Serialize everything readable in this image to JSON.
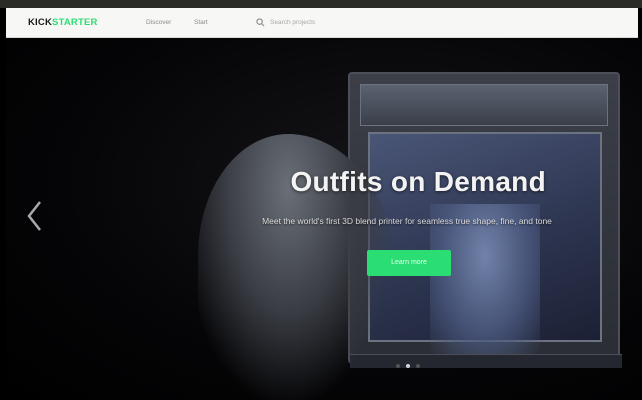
{
  "navbar": {
    "logo_main": "KICK",
    "logo_accent": "STARTER",
    "links": [
      "Discover",
      "Start"
    ],
    "search_placeholder": "Search projects"
  },
  "hero": {
    "title": "Outfits on Demand",
    "subtitle": "Meet the world's first 3D blend printer for seamless true shape, fine, and tone",
    "cta_label": "Learn more"
  },
  "carousel": {
    "slide_count": 3,
    "active_index": 1
  },
  "colors": {
    "accent": "#2bde73",
    "nav_bg": "#f7f7f5",
    "hero_bg": "#000000"
  }
}
